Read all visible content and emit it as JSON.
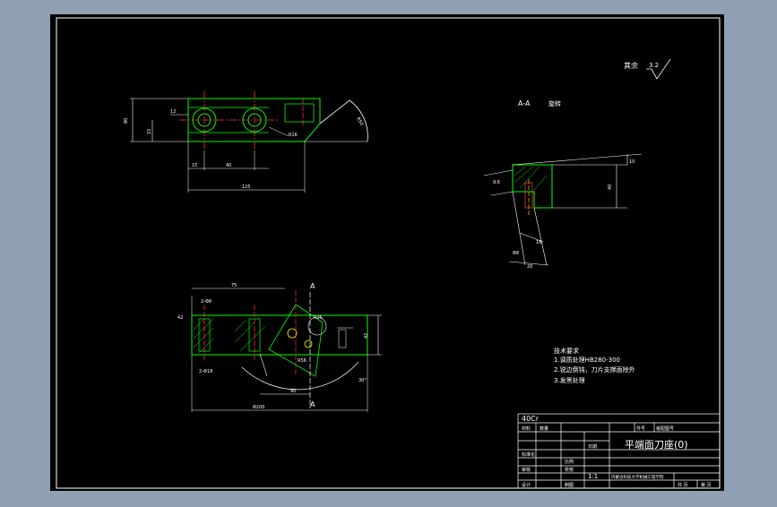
{
  "surface_note": {
    "label": "其余",
    "roughness": "3.2"
  },
  "section_view": {
    "label": "A-A",
    "rotate": "旋转"
  },
  "section_markers": [
    "A",
    "A"
  ],
  "top_view_dims": [
    "80",
    "15",
    "40",
    "125",
    "R50",
    "R16",
    "12",
    "Φ"
  ],
  "front_view_dims": [
    "75",
    "2-Φ8",
    "2-Φ18",
    "Φ200",
    "42",
    "R35",
    "R56",
    "30°",
    "A",
    "90"
  ],
  "section_dims": [
    "9.6",
    "10",
    "40",
    "Φ8",
    "16",
    "20"
  ],
  "tech_requirements": {
    "title": "技术要求",
    "items": [
      "1.调质处理HB280-300",
      "2.锐边倒钝，刀片支撑面除外",
      "3.发黑处理"
    ]
  },
  "title_block": {
    "material": "40Cr",
    "part_name": "平端面刀座(0)",
    "scale": "1:1",
    "row_labels": [
      "材料",
      "数量",
      "件号",
      "装配图号",
      "标准化",
      "审核",
      "设计",
      "制图",
      "校核",
      "日期",
      "共 页",
      "第 页",
      "比例",
      "重量"
    ],
    "small_note": "内蒙古科技大学机械工程学院"
  },
  "colors": {
    "paper": "#000000",
    "frame": "#ffffff",
    "part_outline": "#00ff00",
    "centerline": "#ff3333",
    "dimension": "#ffffff",
    "hatch": "#00ff00",
    "accent": "#ffff00"
  }
}
